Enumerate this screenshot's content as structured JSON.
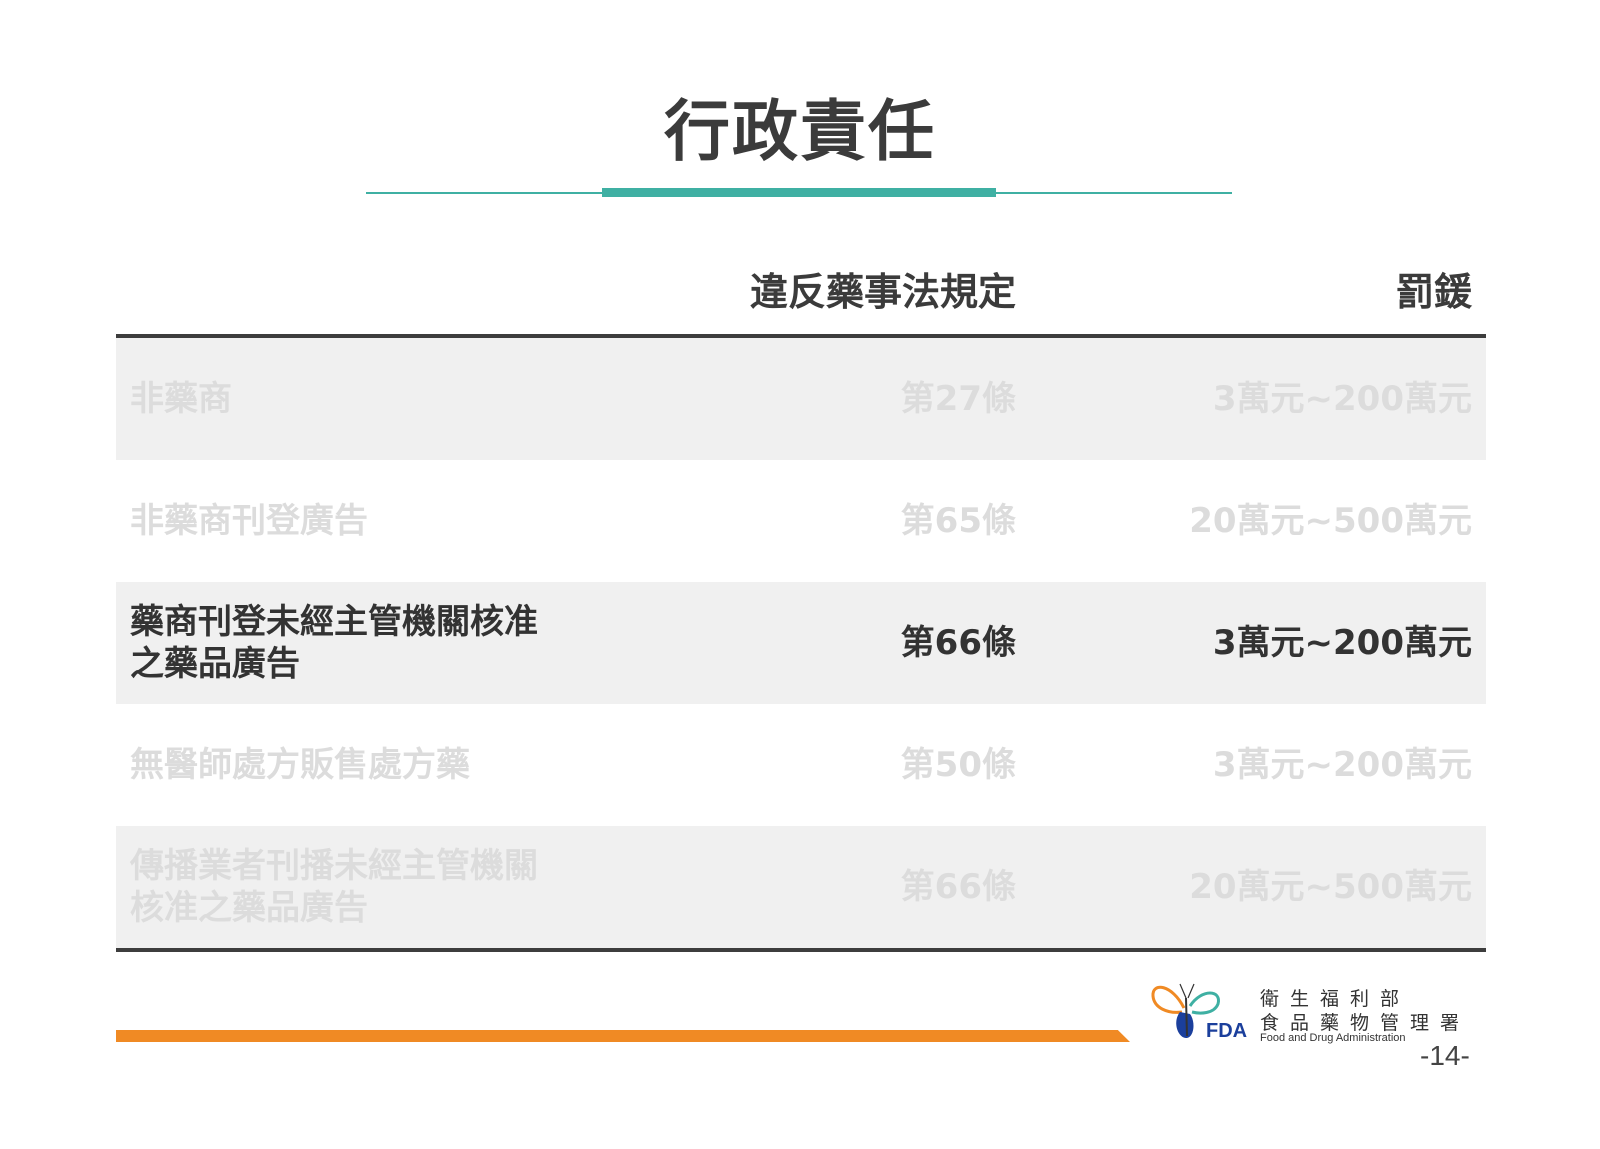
{
  "title": "行政責任",
  "table": {
    "header": {
      "law": "違反藥事法規定",
      "fine": "罰鍰"
    },
    "rows": [
      {
        "desc": "非藥商",
        "law": "第27條",
        "fine": "3萬元~200萬元",
        "shaded": true,
        "highlighted": false
      },
      {
        "desc": "非藥商刊登廣告",
        "law": "第65條",
        "fine": "20萬元~500萬元",
        "shaded": false,
        "highlighted": false
      },
      {
        "desc": "藥商刊登未經主管機關核准之藥品廣告",
        "law": "第66條",
        "fine": "3萬元~200萬元",
        "shaded": true,
        "highlighted": true
      },
      {
        "desc": "無醫師處方販售處方藥",
        "law": "第50條",
        "fine": "3萬元~200萬元",
        "shaded": false,
        "highlighted": false
      },
      {
        "desc": "傳播業者刊播未經主管機關核准之藥品廣告",
        "law": "第66條",
        "fine": "20萬元~500萬元",
        "shaded": true,
        "highlighted": false
      }
    ]
  },
  "footer": {
    "logo": {
      "mark": "FDA",
      "org_line1": "衛生福利部",
      "org_line2": "食品藥物管理署",
      "org_line3": "Food and Drug Administration",
      "icon": "butterfly-logo-icon"
    },
    "page_number": "-14-"
  },
  "colors": {
    "accent_teal": "#3fb0a3",
    "accent_orange": "#f08a24",
    "text_dark": "#3b3b3b",
    "text_dim": "#dcdcdc",
    "row_shade": "#f0f0f0"
  }
}
